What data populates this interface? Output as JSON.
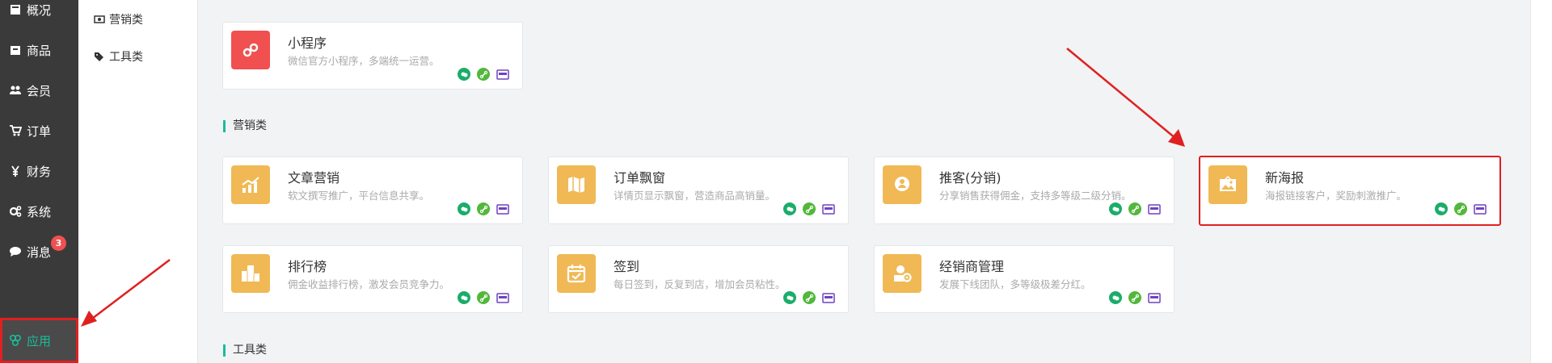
{
  "sidebar": {
    "items": [
      {
        "label": "概况"
      },
      {
        "label": "商品"
      },
      {
        "label": "会员"
      },
      {
        "label": "订单"
      },
      {
        "label": "财务"
      },
      {
        "label": "系统"
      },
      {
        "label": "消息",
        "badge": "3"
      },
      {
        "label": "应用"
      }
    ],
    "active_color": "#1abc9c"
  },
  "subnav": {
    "items": [
      {
        "label": "营销类"
      },
      {
        "label": "工具类"
      }
    ]
  },
  "sections": [
    {
      "title": "营销类"
    },
    {
      "title": "工具类"
    }
  ],
  "cards": [
    {
      "title": "小程序",
      "desc": "微信官方小程序，多端统一运营。",
      "icon": "link-icon",
      "color": "#f0504f"
    },
    {
      "title": "文章营销",
      "desc": "软文撰写推广，平台信息共享。",
      "icon": "chart-icon",
      "color": "#f0b955"
    },
    {
      "title": "订单飘窗",
      "desc": "详情页显示飘窗，营造商品高销量。",
      "icon": "map-icon",
      "color": "#f0b955"
    },
    {
      "title": "推客(分销)",
      "desc": "分享销售获得佣金，支持多等级二级分销。",
      "icon": "user-pin-icon",
      "color": "#f0b955"
    },
    {
      "title": "新海报",
      "desc": "海报链接客户，奖励刺激推广。",
      "icon": "picture-icon",
      "color": "#f0b955"
    },
    {
      "title": "排行榜",
      "desc": "佣金收益排行榜，激发会员竞争力。",
      "icon": "podium-icon",
      "color": "#f0b955"
    },
    {
      "title": "签到",
      "desc": "每日签到，反复到店，增加会员粘性。",
      "icon": "calendar-check-icon",
      "color": "#f0b955"
    },
    {
      "title": "经销商管理",
      "desc": "发展下线团队，多等级极差分红。",
      "icon": "dealer-icon",
      "color": "#f0b955"
    }
  ],
  "platform_icons": [
    "wechat-icon",
    "link-icon",
    "app-icon"
  ]
}
